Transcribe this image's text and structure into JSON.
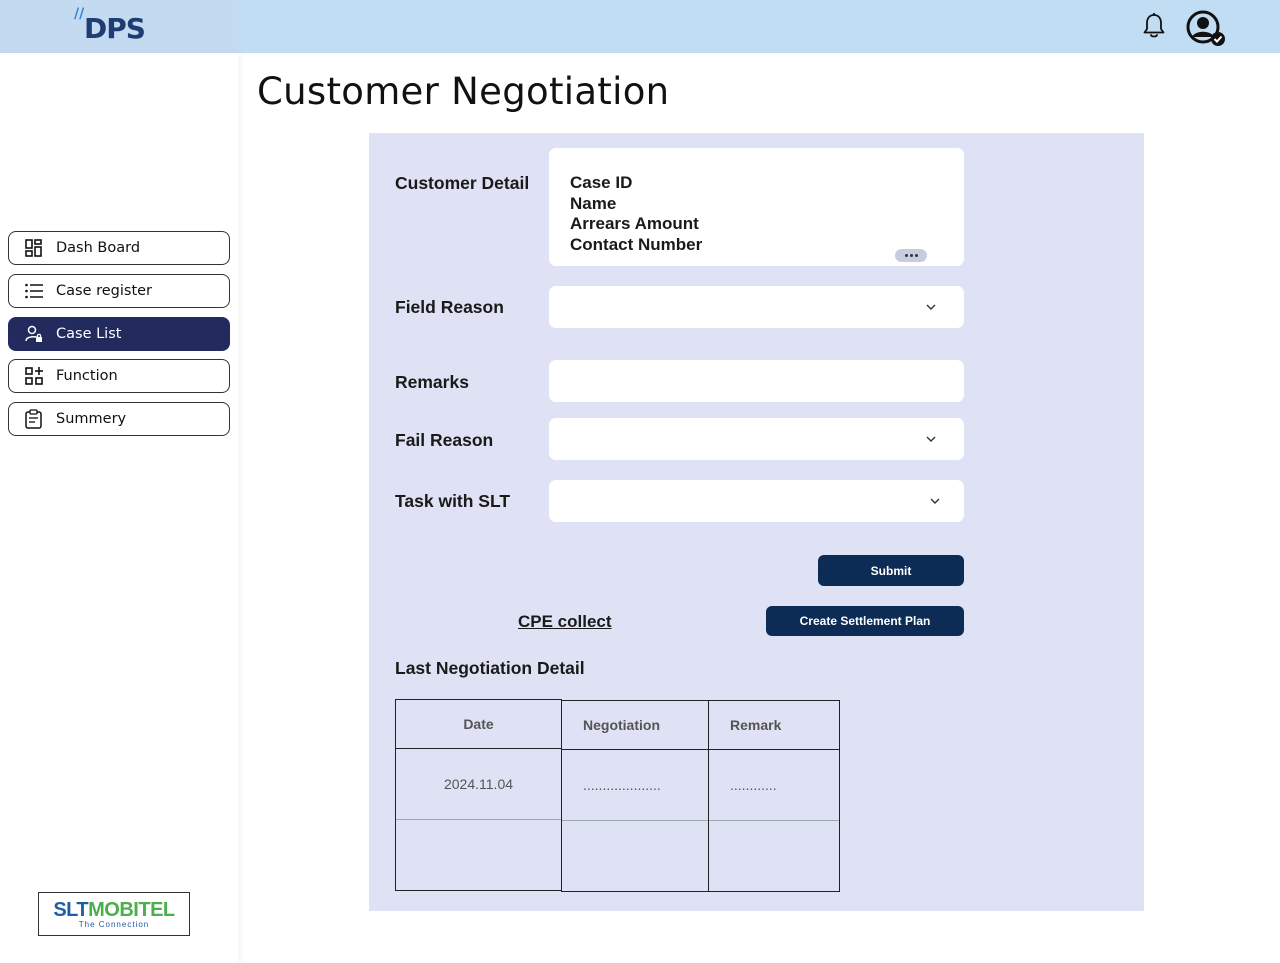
{
  "header": {
    "logo_text": "DPS",
    "bell_icon": "bell-icon",
    "user_icon": "user-account-icon"
  },
  "sidebar": {
    "items": [
      {
        "label": "Dash Board",
        "icon": "dashboard-icon",
        "active": false
      },
      {
        "label": "Case register",
        "icon": "list-icon",
        "active": false
      },
      {
        "label": "Case List",
        "icon": "user-lock-icon",
        "active": true
      },
      {
        "label": "Function",
        "icon": "grid-plus-icon",
        "active": false
      },
      {
        "label": "Summery",
        "icon": "clipboard-icon",
        "active": false
      }
    ],
    "brand": {
      "name_part1": "SLT",
      "name_part2": "MOBITEL",
      "tagline": "The Connection"
    }
  },
  "main": {
    "title": "Customer Negotiation",
    "form": {
      "customer_detail_label": "Customer Detail",
      "customer_detail_lines": [
        "Case ID",
        "Name",
        "Arrears Amount",
        "Contact Number"
      ],
      "field_reason_label": "Field Reason",
      "field_reason_value": "",
      "remarks_label": "Remarks",
      "remarks_value": "",
      "fail_reason_label": "Fail Reason",
      "fail_reason_value": "",
      "task_label": "Task with SLT",
      "task_value": "",
      "submit_label": "Submit",
      "cpe_link": "CPE collect",
      "settlement_label": "Create Settlement Plan"
    },
    "last_negotiation": {
      "title": "Last Negotiation Detail",
      "columns": [
        "Date",
        "Negotiation",
        "Remark"
      ],
      "rows": [
        [
          "2024.11.04",
          "....................",
          "............"
        ],
        [
          "",
          "",
          ""
        ]
      ]
    }
  },
  "colors": {
    "topbar": "#c1ddf4",
    "panel": "#dfe2f4",
    "primary_button": "#0c2b55",
    "active_nav": "#222a5e"
  }
}
